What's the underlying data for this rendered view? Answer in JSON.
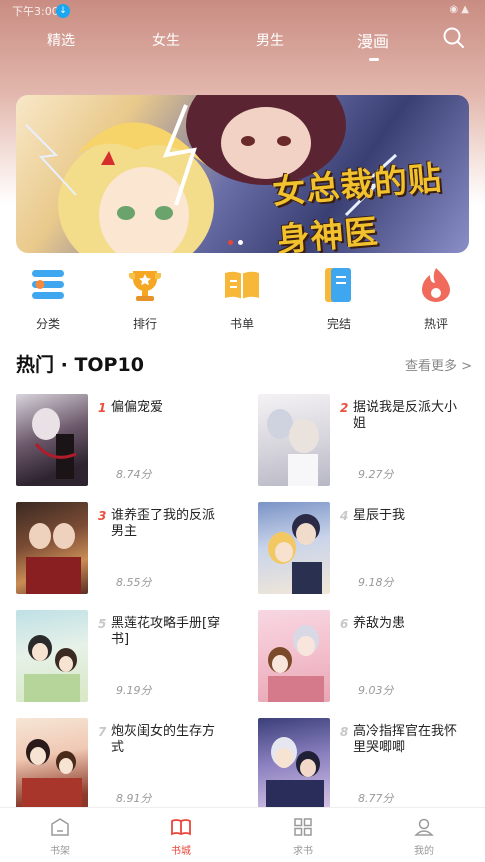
{
  "status_bar": {
    "time": "下午3:00",
    "download_icon": "↓",
    "right_icons": "◉ ▲"
  },
  "tabs": [
    {
      "label": "精选"
    },
    {
      "label": "女生"
    },
    {
      "label": "男生"
    },
    {
      "label": "漫画"
    }
  ],
  "active_tab": "漫画",
  "banner": {
    "title": "女总裁的贴身神医",
    "slide_count": 2,
    "active_slide": 1
  },
  "categories": [
    {
      "label": "分类",
      "icon": "list-icon"
    },
    {
      "label": "排行",
      "icon": "trophy-icon"
    },
    {
      "label": "书单",
      "icon": "book-list-icon"
    },
    {
      "label": "完结",
      "icon": "bookmark-icon"
    },
    {
      "label": "热评",
      "icon": "flame-icon"
    }
  ],
  "section": {
    "title": "热门 · TOP10",
    "more": "查看更多 >"
  },
  "books": [
    {
      "rank": "1",
      "name": "偏偏宠爱",
      "score": "8.74分"
    },
    {
      "rank": "2",
      "name": "据说我是反派大小姐",
      "score": "9.27分"
    },
    {
      "rank": "3",
      "name": "谁养歪了我的反派男主",
      "score": "8.55分"
    },
    {
      "rank": "4",
      "name": "星辰于我",
      "score": "9.18分"
    },
    {
      "rank": "5",
      "name": "黑莲花攻略手册[穿书]",
      "score": "9.19分"
    },
    {
      "rank": "6",
      "name": "养敌为患",
      "score": "9.03分"
    },
    {
      "rank": "7",
      "name": "炮灰闺女的生存方式",
      "score": "8.91分"
    },
    {
      "rank": "8",
      "name": "高冷指挥官在我怀里哭唧唧",
      "score": "8.77分"
    }
  ],
  "rank_colors": {
    "top": "#e94f3c",
    "rest": "#c8c8c8"
  },
  "bottom_nav": [
    {
      "label": "书架",
      "icon": "bookshelf-icon"
    },
    {
      "label": "书城",
      "icon": "open-book-icon"
    },
    {
      "label": "求书",
      "icon": "grid-icon"
    },
    {
      "label": "我的",
      "icon": "user-icon"
    }
  ],
  "active_nav": "书城",
  "accent_color": "#e9463b"
}
